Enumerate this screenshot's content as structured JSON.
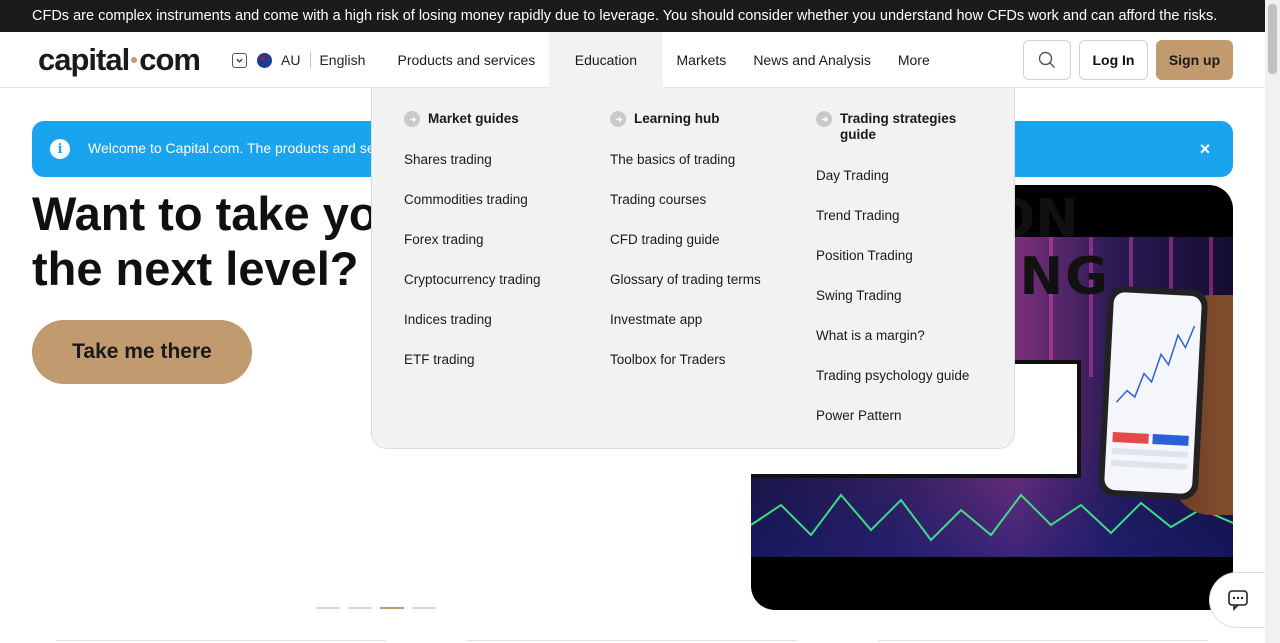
{
  "risk_warning": "CFDs are complex instruments and come with a high risk of losing money rapidly due to leverage. You should consider whether you understand how CFDs work and can afford the risks.",
  "header": {
    "logo_left": "capital",
    "logo_right": "com",
    "region": "AU",
    "language": "English",
    "nav": [
      {
        "label": "Products and services"
      },
      {
        "label": "Education"
      },
      {
        "label": "Markets"
      },
      {
        "label": "News and Analysis"
      },
      {
        "label": "More"
      }
    ],
    "login_label": "Log In",
    "signup_label": "Sign up"
  },
  "mega_menu": {
    "columns": [
      {
        "heading": "Market guides",
        "links": [
          "Shares trading",
          "Commodities trading",
          "Forex trading",
          "Cryptocurrency trading",
          "Indices trading",
          "ETF trading"
        ]
      },
      {
        "heading": "Learning hub",
        "links": [
          "The basics of trading",
          "Trading courses",
          "CFD trading guide",
          "Glossary of trading terms",
          "Investmate app",
          "Toolbox for Traders"
        ]
      },
      {
        "heading_line1": "Trading strategies",
        "heading_line2": "guide",
        "links": [
          "Day Trading",
          "Trend Trading",
          "Position Trading",
          "Swing Trading",
          "What is a margin?",
          "Trading psychology guide",
          "Power Pattern"
        ]
      }
    ]
  },
  "welcome_banner": {
    "text": "Welcome to Capital.com. The products and serv",
    "info_icon": "i",
    "close_icon": "×"
  },
  "hero": {
    "title_line1": "Want to take yo",
    "title_line2": "the next level?",
    "cta_label": "Take me there",
    "image_text_top": "ON",
    "image_text_main": "O TRADING"
  },
  "carousel": {
    "dot_count": 4,
    "active_index": 2
  },
  "colors": {
    "accent": "#c29a6f",
    "banner": "#1aa3ef",
    "risk_bar": "#1b1b1b",
    "menu_bg": "#f2f2f2"
  }
}
